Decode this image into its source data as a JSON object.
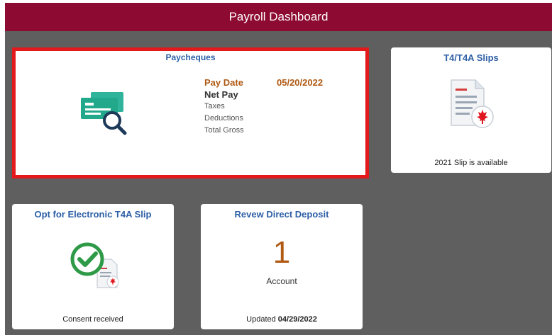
{
  "header": {
    "title": "Payroll Dashboard"
  },
  "colors": {
    "header_bg": "#8d0a32",
    "tile_title": "#2d5fa6",
    "highlight_border": "#e3191b",
    "accent_orange": "#b05a13",
    "panel_bg": "#5f5f5f"
  },
  "paycheques": {
    "title": "Paycheques",
    "icon": "paycheque-search-icon",
    "pay_date_label": "Pay Date",
    "pay_date_value": "05/20/2022",
    "net_pay_label": "Net Pay",
    "taxes_label": "Taxes",
    "deductions_label": "Deductions",
    "total_gross_label": "Total Gross"
  },
  "t4": {
    "title": "T4/T4A Slips",
    "icon": "document-maple-leaf-icon",
    "footer": "2021 Slip is available"
  },
  "opt_in": {
    "title": "Opt for Electronic T4A Slip",
    "icon": "checkmark-document-icon",
    "footer": "Consent received"
  },
  "direct_deposit": {
    "title": "Revew Direct Deposit",
    "count": "1",
    "count_label": "Account",
    "updated_label": "Updated",
    "updated_date": "04/29/2022"
  }
}
